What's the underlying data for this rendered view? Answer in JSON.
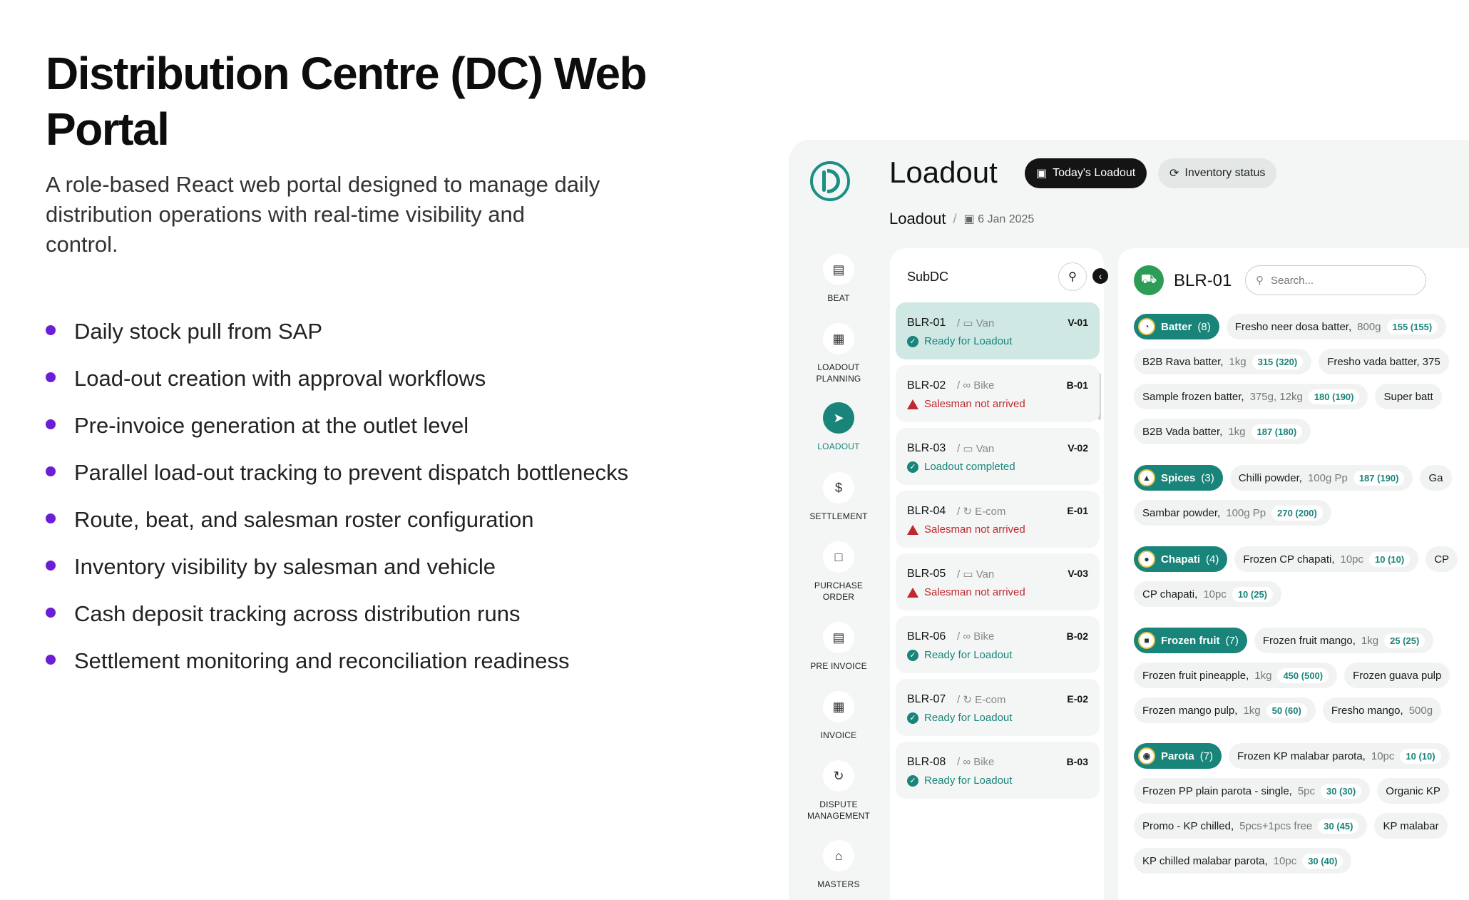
{
  "hero": {
    "title": "Distribution Centre (DC) Web Portal",
    "subtitle": "A role-based React web portal designed to manage daily distribution operations with real-time visibility and control."
  },
  "features": [
    "Daily stock pull from SAP",
    "Load-out creation with approval workflows",
    "Pre-invoice generation at the outlet level",
    "Parallel load-out tracking to prevent dispatch bottlenecks",
    "Route, beat, and salesman roster configuration",
    "Inventory visibility by salesman and vehicle",
    "Cash deposit tracking across distribution runs",
    "Settlement monitoring and reconciliation readiness"
  ],
  "colors": {
    "accent": "#19847a",
    "bullet": "#6a1fd6",
    "danger": "#c0282f"
  },
  "sidebar": {
    "items": [
      {
        "label": "BEAT",
        "icon": "clipboard-icon"
      },
      {
        "label": "LOADOUT PLANNING",
        "icon": "planning-icon"
      },
      {
        "label": "LOADOUT",
        "icon": "cart-icon",
        "active": true
      },
      {
        "label": "SETTLEMENT",
        "icon": "money-icon"
      },
      {
        "label": "PURCHASE ORDER",
        "icon": "bag-icon"
      },
      {
        "label": "PRE INVOICE",
        "icon": "receipt-icon"
      },
      {
        "label": "INVOICE",
        "icon": "invoice-icon"
      },
      {
        "label": "DISPUTE MANAGEMENT",
        "icon": "dispute-icon"
      },
      {
        "label": "MASTERS",
        "icon": "warehouse-icon"
      }
    ]
  },
  "header": {
    "title": "Loadout",
    "tab_today": "Today's Loadout",
    "tab_inventory": "Inventory status",
    "breadcrumb": "Loadout",
    "breadcrumb_sep": "/",
    "date": "6 Jan 2025"
  },
  "subdc": {
    "title": "SubDC",
    "vehicles": [
      {
        "code": "BLR-01",
        "type": "Van",
        "id": "V-01",
        "status": "Ready for Loadout",
        "state": "ok"
      },
      {
        "code": "BLR-02",
        "type": "Bike",
        "id": "B-01",
        "status": "Salesman not arrived",
        "state": "bad"
      },
      {
        "code": "BLR-03",
        "type": "Van",
        "id": "V-02",
        "status": "Loadout completed",
        "state": "ok"
      },
      {
        "code": "BLR-04",
        "type": "E-com",
        "id": "E-01",
        "status": "Salesman not arrived",
        "state": "bad"
      },
      {
        "code": "BLR-05",
        "type": "Van",
        "id": "V-03",
        "status": "Salesman not arrived",
        "state": "bad"
      },
      {
        "code": "BLR-06",
        "type": "Bike",
        "id": "B-02",
        "status": "Ready for Loadout",
        "state": "ok"
      },
      {
        "code": "BLR-07",
        "type": "E-com",
        "id": "E-02",
        "status": "Ready for Loadout",
        "state": "ok"
      },
      {
        "code": "BLR-08",
        "type": "Bike",
        "id": "B-03",
        "status": "Ready for Loadout",
        "state": "ok"
      }
    ]
  },
  "detail": {
    "title": "BLR-01",
    "search_placeholder": "Search...",
    "categories": [
      {
        "name": "Batter",
        "count": "(8)"
      },
      {
        "name": "Spices",
        "count": "(3)"
      },
      {
        "name": "Chapati",
        "count": "(4)"
      },
      {
        "name": "Frozen fruit",
        "count": "(7)"
      },
      {
        "name": "Parota",
        "count": "(7)"
      }
    ],
    "rows": [
      [
        {
          "name": "Fresho neer dosa batter,",
          "size": "800g",
          "qty": "155 (155)"
        }
      ],
      [
        {
          "name": "B2B Rava batter,",
          "size": "1kg",
          "qty": "315 (320)"
        },
        {
          "name": "Fresho vada batter, 375",
          "size": "",
          "qty": ""
        }
      ],
      [
        {
          "name": "Sample frozen batter,",
          "size": "375g, 12kg",
          "qty": "180 (190)"
        },
        {
          "name": "Super batt",
          "size": "",
          "qty": ""
        }
      ],
      [
        {
          "name": "B2B Vada batter,",
          "size": "1kg",
          "qty": "187 (180)"
        }
      ],
      [
        {
          "name": "Chilli powder,",
          "size": "100g Pp",
          "qty": "187 (190)"
        },
        {
          "name": "Ga",
          "size": "",
          "qty": ""
        }
      ],
      [
        {
          "name": "Sambar powder,",
          "size": "100g Pp",
          "qty": "270 (200)"
        }
      ],
      [
        {
          "name": "Frozen CP chapati,",
          "size": "10pc",
          "qty": "10 (10)"
        },
        {
          "name": "CP",
          "size": "",
          "qty": ""
        }
      ],
      [
        {
          "name": "CP chapati,",
          "size": "10pc",
          "qty": "10 (25)"
        }
      ],
      [
        {
          "name": "Frozen fruit mango,",
          "size": "1kg",
          "qty": "25 (25)"
        }
      ],
      [
        {
          "name": "Frozen fruit pineapple,",
          "size": "1kg",
          "qty": "450 (500)"
        },
        {
          "name": "Frozen guava pulp",
          "size": "",
          "qty": ""
        }
      ],
      [
        {
          "name": "Frozen mango pulp,",
          "size": "1kg",
          "qty": "50 (60)"
        },
        {
          "name": "Fresho mango,",
          "size": "500g",
          "qty": ""
        }
      ],
      [
        {
          "name": "Frozen KP malabar parota,",
          "size": "10pc",
          "qty": "10 (10)"
        }
      ],
      [
        {
          "name": "Frozen PP plain parota - single,",
          "size": "5pc",
          "qty": "30 (30)"
        },
        {
          "name": "Organic KP",
          "size": "",
          "qty": ""
        }
      ],
      [
        {
          "name": "Promo - KP chilled,",
          "size": "5pcs+1pcs free",
          "qty": "30 (45)"
        },
        {
          "name": "KP malabar",
          "size": "",
          "qty": ""
        }
      ],
      [
        {
          "name": "KP chilled malabar parota,",
          "size": "10pc",
          "qty": "30 (40)"
        }
      ]
    ]
  }
}
